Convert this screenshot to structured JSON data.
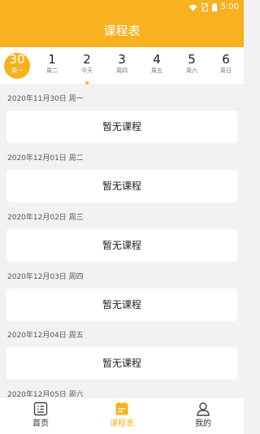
{
  "status_bar": {
    "time": "5:00"
  },
  "title": "课程表",
  "days": [
    {
      "num": "30",
      "label": "周一",
      "selected": true,
      "dot": false
    },
    {
      "num": "1",
      "label": "周二",
      "selected": false,
      "dot": false
    },
    {
      "num": "2",
      "label": "今天",
      "selected": false,
      "dot": true
    },
    {
      "num": "3",
      "label": "周四",
      "selected": false,
      "dot": false
    },
    {
      "num": "4",
      "label": "周五",
      "selected": false,
      "dot": false
    },
    {
      "num": "5",
      "label": "周六",
      "selected": false,
      "dot": false
    },
    {
      "num": "6",
      "label": "周日",
      "selected": false,
      "dot": false
    }
  ],
  "schedule": [
    {
      "date": "2020年11月30日 周一",
      "card": "暂无课程"
    },
    {
      "date": "2020年12月01日 周二",
      "card": "暂无课程"
    },
    {
      "date": "2020年12月02日 周三",
      "card": "暂无课程"
    },
    {
      "date": "2020年12月03日 周四",
      "card": "暂无课程"
    },
    {
      "date": "2020年12月04日 周五",
      "card": "暂无课程"
    },
    {
      "date": "2020年12月05日 周六",
      "card": ""
    }
  ],
  "tabs": [
    {
      "label": "首页",
      "icon": "home-icon",
      "active": false
    },
    {
      "label": "课程表",
      "icon": "schedule-icon",
      "active": true
    },
    {
      "label": "我的",
      "icon": "profile-icon",
      "active": false
    }
  ],
  "colors": {
    "accent": "#f8b11f",
    "background": "#f2f2f2"
  }
}
